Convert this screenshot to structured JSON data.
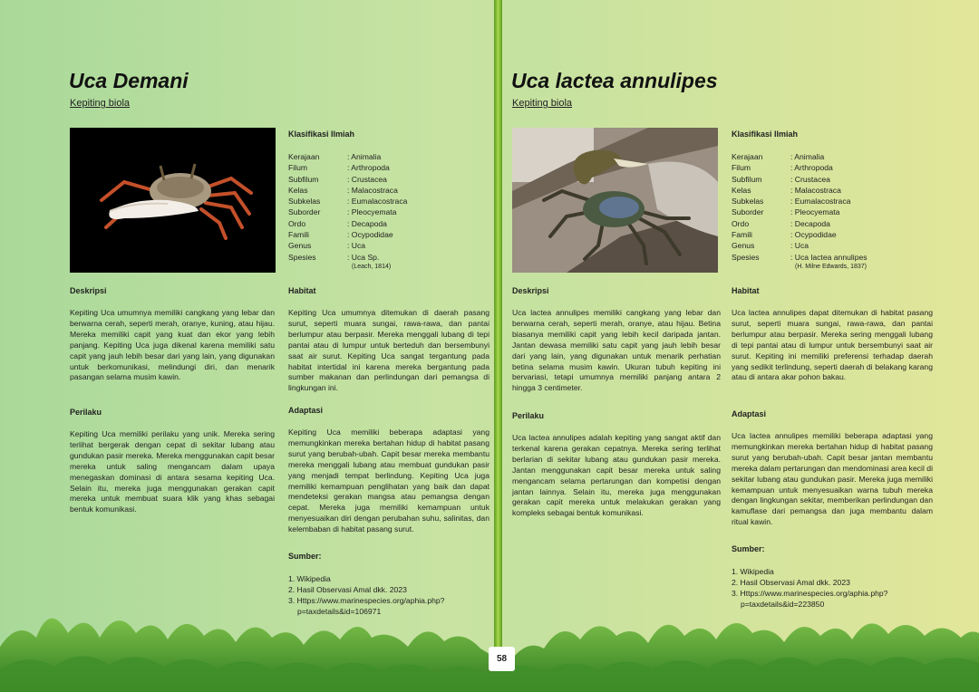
{
  "page_number": "58",
  "left": {
    "title": "Uca Demani",
    "subtitle": "Kepiting biola",
    "klasifikasi_heading": "Klasifikasi Ilmiah",
    "klasifikasi": [
      {
        "k": "Kerajaan",
        "v": ": Animalia"
      },
      {
        "k": "Filum",
        "v": ": Arthropoda"
      },
      {
        "k": "Subfilum",
        "v": ": Crustacea"
      },
      {
        "k": "Kelas",
        "v": ": Malacostraca"
      },
      {
        "k": "Subkelas",
        "v": ": Eumalacostraca"
      },
      {
        "k": "Suborder",
        "v": ": Pleocyemata"
      },
      {
        "k": "Ordo",
        "v": ": Decapoda"
      },
      {
        "k": "Famili",
        "v": ": Ocypodidae"
      },
      {
        "k": "Genus",
        "v": ": Uca"
      },
      {
        "k": "Spesies",
        "v": ": Uca Sp."
      }
    ],
    "authority": "(Leach, 1814)",
    "deskripsi_heading": "Deskripsi",
    "deskripsi": "Kepiting Uca umumnya memiliki cangkang yang lebar dan berwarna cerah, seperti merah, oranye, kuning, atau hijau. Mereka memiliki capit yang kuat dan ekor yang lebih panjang. Kepiting Uca juga dikenal karena memiliki satu capit yang jauh lebih besar dari yang lain, yang digunakan untuk berkomunikasi, melindungi diri, dan menarik pasangan selama musim kawin.",
    "perilaku_heading": "Perilaku",
    "perilaku": "Kepiting Uca memiliki perilaku yang unik. Mereka sering terlihat bergerak dengan cepat di sekitar lubang atau gundukan pasir mereka. Mereka menggunakan capit besar mereka untuk saling mengancam dalam upaya menegaskan dominasi di antara sesama kepiting Uca. Selain itu, mereka juga menggunakan gerakan capit mereka untuk membuat suara klik yang khas sebagai bentuk komunikasi.",
    "habitat_heading": "Habitat",
    "habitat": "Kepiting Uca umumnya ditemukan di daerah pasang surut, seperti muara sungai, rawa-rawa, dan pantai berlumpur atau berpasir. Mereka menggali lubang di tepi pantai atau di lumpur untuk berteduh dan bersembunyi saat air surut. Kepiting Uca sangat tergantung pada habitat intertidal ini karena mereka bergantung pada sumber makanan dan perlindungan dari pemangsa di lingkungan ini.",
    "adaptasi_heading": "Adaptasi",
    "adaptasi": "Kepiting Uca memiliki beberapa adaptasi yang memungkinkan mereka bertahan hidup di habitat pasang surut yang berubah-ubah. Capit besar mereka membantu mereka menggali lubang atau membuat gundukan pasir yang menjadi tempat berlindung. Kepiting Uca juga memiliki kemampuan penglihatan yang baik dan dapat mendeteksi gerakan mangsa atau pemangsa dengan cepat. Mereka juga memiliki kemampuan untuk menyesuaikan diri dengan perubahan suhu, salinitas, dan kelembaban di habitat pasang surut.",
    "sumber_heading": "Sumber:",
    "sumber": [
      "1. Wikipedia",
      "2. Hasil Observasi Amal dkk. 2023",
      "3. Https://www.marinespecies.org/aphia.php?",
      "p=taxdetails&id=106971"
    ]
  },
  "right": {
    "title": "Uca lactea annulipes",
    "subtitle": "Kepiting biola",
    "klasifikasi_heading": "Klasifikasi Ilmiah",
    "klasifikasi": [
      {
        "k": "Kerajaan",
        "v": ": Animalia"
      },
      {
        "k": "Filum",
        "v": ": Arthropoda"
      },
      {
        "k": "Subfilum",
        "v": ": Crustacea"
      },
      {
        "k": "Kelas",
        "v": ": Malacostraca"
      },
      {
        "k": "Subkelas",
        "v": ": Eumalacostraca"
      },
      {
        "k": "Suborder",
        "v": ": Pleocyemata"
      },
      {
        "k": "Ordo",
        "v": ": Decapoda"
      },
      {
        "k": "Famili",
        "v": ": Ocypodidae"
      },
      {
        "k": "Genus",
        "v": ": Uca"
      },
      {
        "k": "Spesies",
        "v": ": Uca lactea annulipes"
      }
    ],
    "authority": "(H. Milne Edwards, 1837)",
    "deskripsi_heading": "Deskripsi",
    "deskripsi": "Uca lactea annulipes memiliki cangkang yang lebar dan berwarna cerah, seperti merah, oranye, atau hijau. Betina biasanya memiliki capit yang lebih kecil daripada jantan. Jantan dewasa memiliki satu capit yang jauh lebih besar dari yang lain, yang digunakan untuk menarik perhatian betina selama musim kawin. Ukuran tubuh kepiting ini bervariasi, tetapi umumnya memiliki panjang antara 2 hingga 3 centimeter.",
    "perilaku_heading": "Perilaku",
    "perilaku": "Uca lactea annulipes adalah kepiting yang sangat aktif dan terkenal karena gerakan cepatnya. Mereka sering terlihat berlarian di sekitar lubang atau gundukan pasir mereka. Jantan menggunakan capit besar mereka untuk saling mengancam selama pertarungan dan kompetisi dengan jantan lainnya. Selain itu, mereka juga menggunakan gerakan capit mereka untuk melakukan gerakan yang kompleks sebagai bentuk komunikasi.",
    "habitat_heading": "Habitat",
    "habitat": "Uca lactea annulipes dapat ditemukan di habitat pasang surut, seperti muara sungai, rawa-rawa, dan pantai berlumpur atau berpasir. Mereka sering menggali lubang di tepi pantai atau di lumpur untuk bersembunyi saat air surut. Kepiting ini memiliki preferensi terhadap daerah yang sedikit terlindung, seperti daerah di belakang karang atau di antara akar pohon bakau.",
    "adaptasi_heading": "Adaptasi",
    "adaptasi": "Uca lactea annulipes memiliki beberapa adaptasi yang memungkinkan mereka bertahan hidup di habitat pasang surut yang berubah-ubah. Capit besar jantan membantu mereka dalam pertarungan dan mendominasi area kecil di sekitar lubang atau gundukan pasir. Mereka juga memiliki kemampuan untuk menyesuaikan warna tubuh mereka dengan lingkungan sekitar, memberikan perlindungan dan kamuflase dari pemangsa dan juga membantu dalam ritual kawin.",
    "sumber_heading": "Sumber:",
    "sumber": [
      "1. Wikipedia",
      "2. Hasil Observasi Amal dkk. 2023",
      "3. Https://www.marinespecies.org/aphia.php?",
      "p=taxdetails&id=223850"
    ]
  }
}
